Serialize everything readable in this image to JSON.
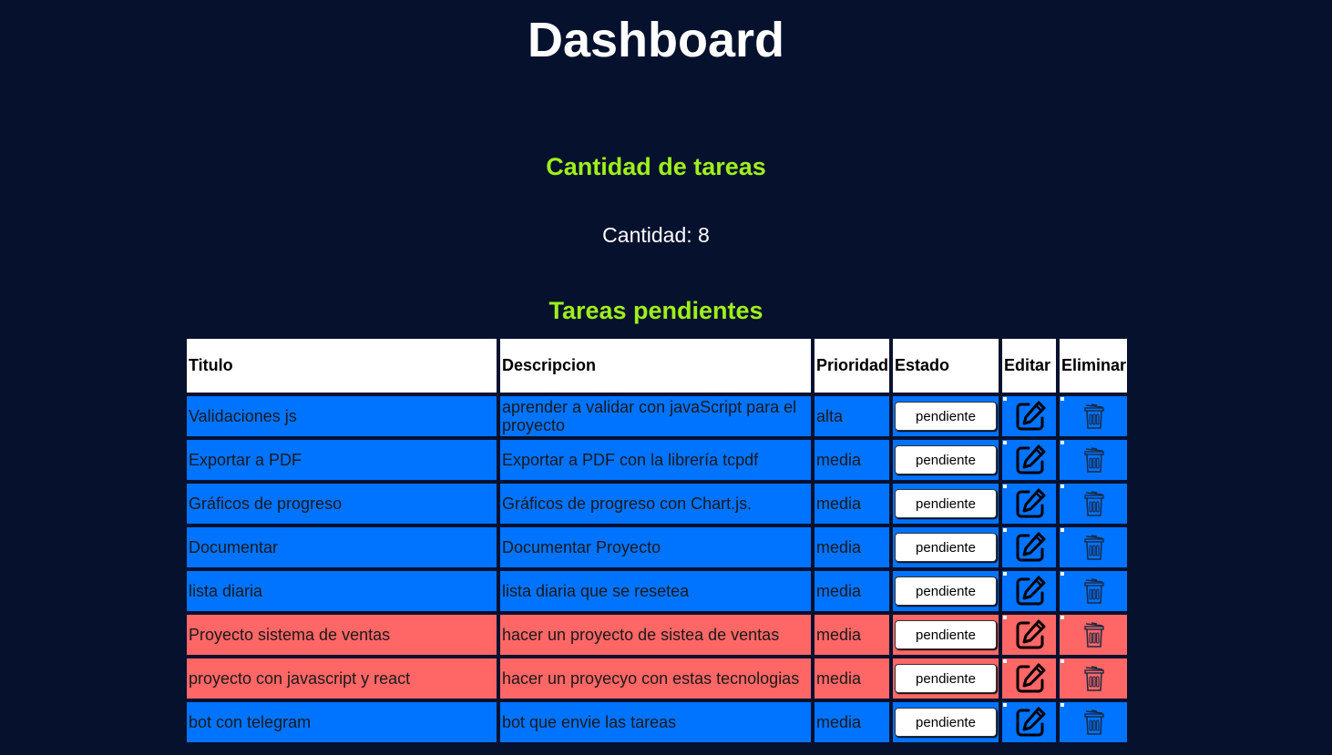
{
  "header": {
    "title": "Dashboard"
  },
  "summary": {
    "heading": "Cantidad de tareas",
    "count_text": "Cantidad: 8"
  },
  "tasks_section": {
    "heading": "Tareas pendientes",
    "columns": [
      "Titulo",
      "Descripcion",
      "Prioridad",
      "Estado",
      "Editar",
      "Eliminar"
    ],
    "rows": [
      {
        "titulo": "Validaciones js",
        "descripcion": "aprender a validar con javaScript para el proyecto",
        "prioridad": "alta",
        "estado": "pendiente",
        "highlight": "blue"
      },
      {
        "titulo": "Exportar a PDF",
        "descripcion": "Exportar a PDF con la librería tcpdf",
        "prioridad": "media",
        "estado": "pendiente",
        "highlight": "blue"
      },
      {
        "titulo": "Gráficos de progreso",
        "descripcion": "Gráficos de progreso con Chart.js.",
        "prioridad": "media",
        "estado": "pendiente",
        "highlight": "blue"
      },
      {
        "titulo": "Documentar",
        "descripcion": "Documentar Proyecto",
        "prioridad": "media",
        "estado": "pendiente",
        "highlight": "blue"
      },
      {
        "titulo": "lista diaria",
        "descripcion": "lista diaria que se resetea",
        "prioridad": "media",
        "estado": "pendiente",
        "highlight": "blue"
      },
      {
        "titulo": "Proyecto sistema de ventas",
        "descripcion": "hacer un proyecto de sistea de ventas",
        "prioridad": "media",
        "estado": "pendiente",
        "highlight": "red"
      },
      {
        "titulo": "proyecto con javascript y react",
        "descripcion": "hacer un proyecyo con estas tecnologias",
        "prioridad": "media",
        "estado": "pendiente",
        "highlight": "red"
      },
      {
        "titulo": "bot con telegram",
        "descripcion": "bot que envie las tareas",
        "prioridad": "media",
        "estado": "pendiente",
        "highlight": "blue"
      }
    ]
  },
  "icons": {
    "edit": "edit-pencil-square-icon",
    "delete": "trash-can-icon"
  },
  "colors": {
    "background": "#06112e",
    "heading_accent": "#9ef01a",
    "row_blue": "#0073ff",
    "row_red": "#ff6666",
    "header_bg": "#ffffff"
  }
}
